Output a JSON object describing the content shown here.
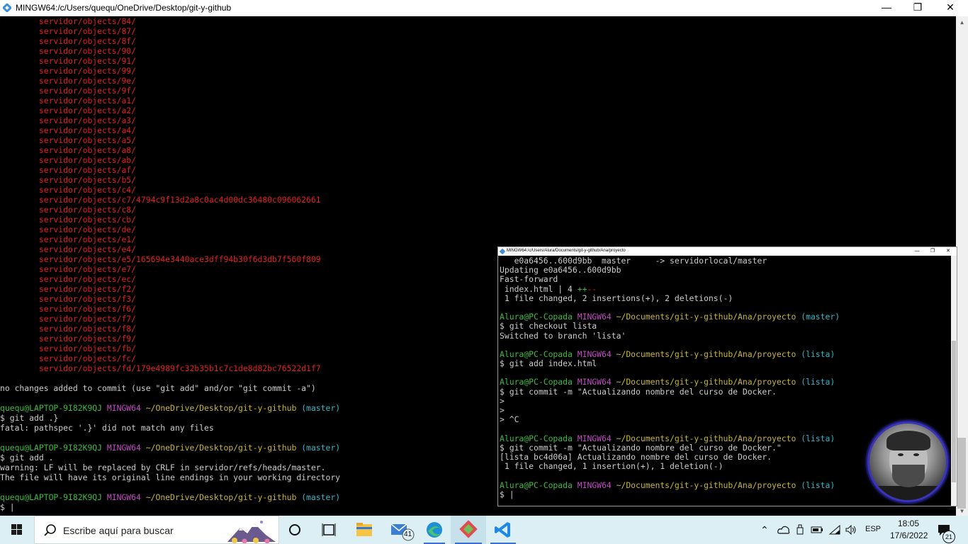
{
  "window": {
    "title": "MINGW64:/c/Users/quequ/OneDrive/Desktop/git-y-github",
    "controls": [
      "—",
      "❐",
      "✕"
    ]
  },
  "main_terminal": {
    "deleted_files": [
      "servidor/objects/84/",
      "servidor/objects/87/",
      "servidor/objects/8f/",
      "servidor/objects/90/",
      "servidor/objects/91/",
      "servidor/objects/99/",
      "servidor/objects/9e/",
      "servidor/objects/9f/",
      "servidor/objects/a1/",
      "servidor/objects/a2/",
      "servidor/objects/a3/",
      "servidor/objects/a4/",
      "servidor/objects/a5/",
      "servidor/objects/a8/",
      "servidor/objects/ab/",
      "servidor/objects/af/",
      "servidor/objects/b5/",
      "servidor/objects/c4/",
      "servidor/objects/c7/4794c9f13d2a8c0ac4d00dc36480c096062661",
      "servidor/objects/c8/",
      "servidor/objects/cb/",
      "servidor/objects/de/",
      "servidor/objects/e1/",
      "servidor/objects/e4/",
      "servidor/objects/e5/165694e3440ace3dff94b30f6d3db7f560f809",
      "servidor/objects/e7/",
      "servidor/objects/ec/",
      "servidor/objects/f2/",
      "servidor/objects/f3/",
      "servidor/objects/f6/",
      "servidor/objects/f7/",
      "servidor/objects/f8/",
      "servidor/objects/f9/",
      "servidor/objects/fb/",
      "servidor/objects/fc/",
      "servidor/objects/fd/179e4989fc32b35b1c7c1de8d82bc76522d1f7"
    ],
    "no_changes": "no changes added to commit (use \"git add\" and/or \"git commit -a\")",
    "prompt_user": "quequ@LAPTOP-9I82K9QJ",
    "prompt_env": "MINGW64",
    "prompt_path": "~/OneDrive/Desktop/git-y-github",
    "prompt_branch": "(master)",
    "cmd1": "$ git add .}",
    "out1": "fatal: pathspec '.}' did not match any files",
    "cmd2": "$ git add .",
    "out2a": "warning: LF will be replaced by CRLF in servidor/refs/heads/master.",
    "out2b": "The file will have its original line endings in your working directory",
    "cursor_prompt": "$ |"
  },
  "second_window": {
    "title": "MINGW64:/c/Users/Alura/Documents/git-y-github/Ana/proyecto",
    "line1": "   e0a6456..600d9bb  master     -> servidorlocal/master",
    "line2": "Updating e0a6456..600d9bb",
    "line3": "Fast-forward",
    "line4a": " index.html | 4 ",
    "line4_plus": "++",
    "line4_minus": "--",
    "line5": " 1 file changed, 2 insertions(+), 2 deletions(-)",
    "user": "Alura@PC-Copada",
    "env": "MINGW64",
    "path": "~/Documents/git-y-github/Ana/proyecto",
    "branch_master": "(master)",
    "branch_lista": "(lista)",
    "c1": "$ git checkout lista",
    "c1out": "Switched to branch 'lista'",
    "c2": "$ git add index.html",
    "c3": "$ git commit -m \"Actualizando nombre del curso de Docker.",
    "gt": ">",
    "ctrlc": "> ^C",
    "c4": "$ git commit -m \"Actualizando nombre del curso de Docker.\"",
    "c4out1": "[lista bc4d06a] Actualizando nombre del curso de Docker.",
    "c4out2": " 1 file changed, 1 insertion(+), 1 deletion(-)",
    "cursor": "$ |"
  },
  "taskbar": {
    "search_placeholder": "Escribe aquí para buscar",
    "mail_badge": "41",
    "language": "ESP",
    "time": "18:05",
    "date": "17/6/2022",
    "notification_badge": "21"
  },
  "colors": {
    "terminal_bg": "#000000",
    "deleted_red": "#e02020",
    "prompt_green": "#3dbb3d",
    "prompt_purple": "#c24bc2",
    "path_yellow": "#c8b535",
    "branch_cyan": "#35b5c5",
    "taskbar_bg": "#dceff5"
  }
}
